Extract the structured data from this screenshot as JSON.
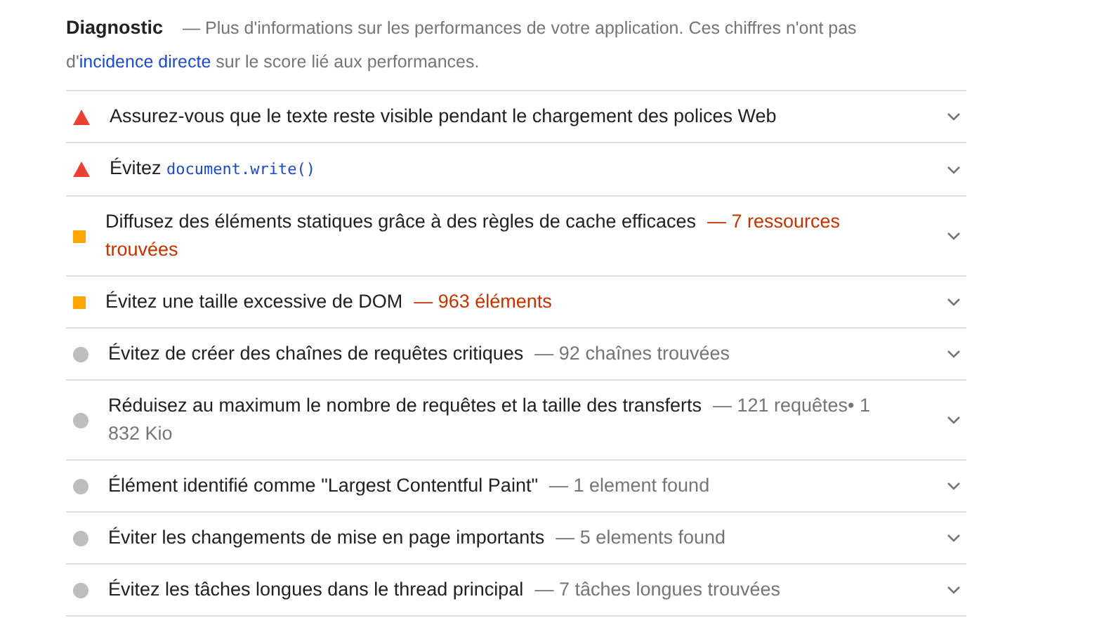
{
  "section": {
    "title": "Diagnostic",
    "description_before": "— Plus d'informations sur les performances de votre application. Ces chiffres n'ont pas d'",
    "link": "incidence directe",
    "description_after": " sur le score lié aux performances."
  },
  "audits": [
    {
      "kind": "fail",
      "title": "Assurez-vous que le texte reste visible pendant le chargement des polices Web"
    },
    {
      "kind": "fail",
      "title": "Évitez ",
      "code": "document.write()"
    },
    {
      "kind": "average",
      "title": "Diffusez des éléments statiques grâce à des règles de cache efficaces",
      "detail": "— 7 ressources trouvées"
    },
    {
      "kind": "average",
      "title": "Évitez une taille excessive de DOM",
      "detail": "— 963 éléments"
    },
    {
      "kind": "info",
      "title": "Évitez de créer des chaînes de requêtes critiques",
      "detail": "— 92 chaînes trouvées"
    },
    {
      "kind": "info",
      "title": "Réduisez au maximum le nombre de requêtes et la taille des transferts",
      "detail": "— 121 requêtes• 1 832 Kio"
    },
    {
      "kind": "info",
      "title": "Élément identifié comme \"Largest Contentful Paint\"",
      "detail": "— 1 element found"
    },
    {
      "kind": "info",
      "title": "Éviter les changements de mise en page importants",
      "detail": "— 5 elements found"
    },
    {
      "kind": "info",
      "title": "Évitez les tâches longues dans le thread principal",
      "detail": "— 7 tâches longues trouvées"
    }
  ]
}
